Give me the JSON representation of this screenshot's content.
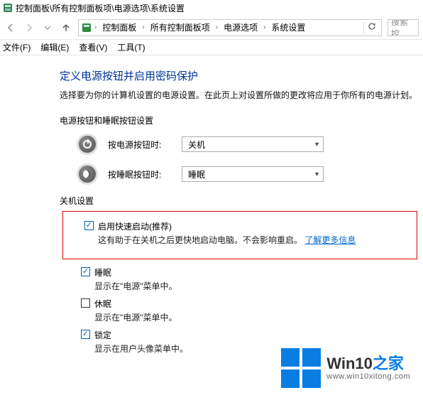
{
  "window": {
    "title": "控制面板\\所有控制面板项\\电源选项\\系统设置"
  },
  "breadcrumb": {
    "items": [
      "控制面板",
      "所有控制面板项",
      "电源选项",
      "系统设置"
    ]
  },
  "search": {
    "placeholder": "搜索控"
  },
  "menu": {
    "file": "文件(F)",
    "edit": "编辑(E)",
    "view": "查看(V)",
    "tools": "工具(T)"
  },
  "page": {
    "title": "定义电源按钮并启用密码保护",
    "desc": "选择要为你的计算机设置的电源设置。在此页上对设置所做的更改将应用于你所有的电源计划。",
    "btn_section": "电源按钮和睡眠按钮设置",
    "power_btn_label": "按电源按钮时:",
    "power_btn_value": "关机",
    "sleep_btn_label": "按睡眠按钮时:",
    "sleep_btn_value": "睡眠",
    "shutdown_section": "关机设置",
    "fast_startup": {
      "label": "启用快速启动(推荐)",
      "desc_prefix": "这有助于在关机之后更快地启动电脑。不会影响重启。",
      "link": "了解更多信息"
    },
    "sleep_opt": {
      "label": "睡眠",
      "desc": "显示在\"电源\"菜单中。"
    },
    "hibernate_opt": {
      "label": "休眠",
      "desc": "显示在\"电源\"菜单中。"
    },
    "lock_opt": {
      "label": "锁定",
      "desc": "显示在用户头像菜单中。"
    }
  },
  "watermark": {
    "brand_a": "Win10",
    "brand_b": "之家",
    "sub": "www.win10xitong.com"
  }
}
